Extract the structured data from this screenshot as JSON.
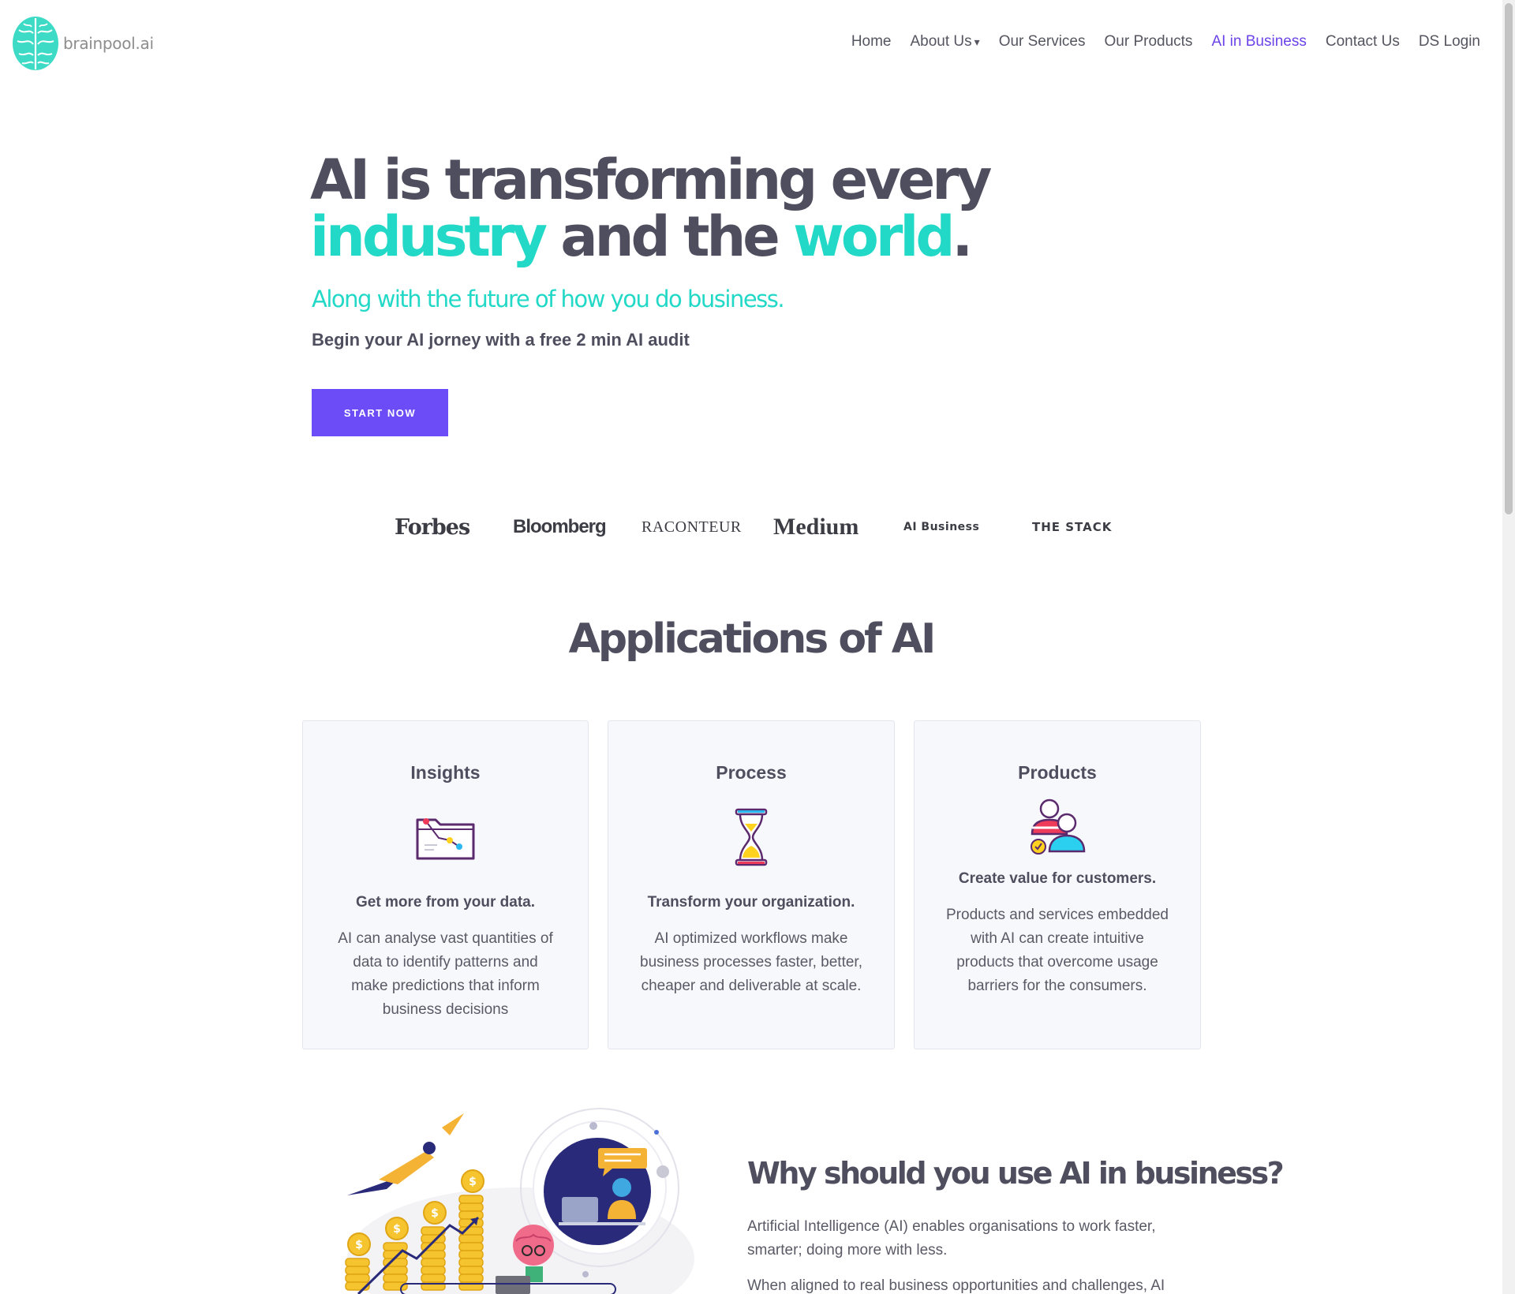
{
  "brand": {
    "logo_text": "brainpool.ai",
    "accent": "#22d8c6",
    "primary": "#6b4cf6",
    "nav_active": "#6b43e8"
  },
  "nav": {
    "items": [
      {
        "label": "Home"
      },
      {
        "label": "About Us",
        "has_dropdown": true,
        "caret": "▾"
      },
      {
        "label": "Our Services"
      },
      {
        "label": "Our Products"
      },
      {
        "label": "AI in Business",
        "active": true
      },
      {
        "label": "Contact Us"
      },
      {
        "label": "DS Login"
      }
    ]
  },
  "hero": {
    "line1": "AI is transforming every",
    "word_industry": "industry",
    "word_and_the": " and the ",
    "word_world": "world",
    "period": ".",
    "subtitle": "Along with the future of how you do business.",
    "audit_text": "Begin your AI jorney with a free 2 min AI audit",
    "cta_label": "START NOW"
  },
  "press_logos": [
    "Forbes",
    "Bloomberg",
    "RACONTEUR",
    "Medium",
    "AI Business",
    "THE STACK"
  ],
  "applications": {
    "title": "Applications of AI",
    "cards": [
      {
        "title": "Insights",
        "icon": "folder-chart-icon",
        "heading": "Get more from your data.",
        "body": "AI can analyse vast quantities of data to identify patterns and make predictions that inform business decisions"
      },
      {
        "title": "Process",
        "icon": "hourglass-icon",
        "heading": "Transform your organization.",
        "body": "AI optimized workflows make business processes faster, better, cheaper and deliverable at scale."
      },
      {
        "title": "Products",
        "icon": "customers-icon",
        "heading": "Create value for customers.",
        "body": "Products and services embedded with AI can create intuitive products that overcome usage barriers for the consumers."
      }
    ]
  },
  "why": {
    "illustration": "business-growth-illustration",
    "title": "Why should you use AI in business?",
    "p1": "Artificial Intelligence (AI) enables organisations to work faster, smarter; doing more with less.",
    "p2": "When aligned to real business opportunities and challenges, AI"
  }
}
